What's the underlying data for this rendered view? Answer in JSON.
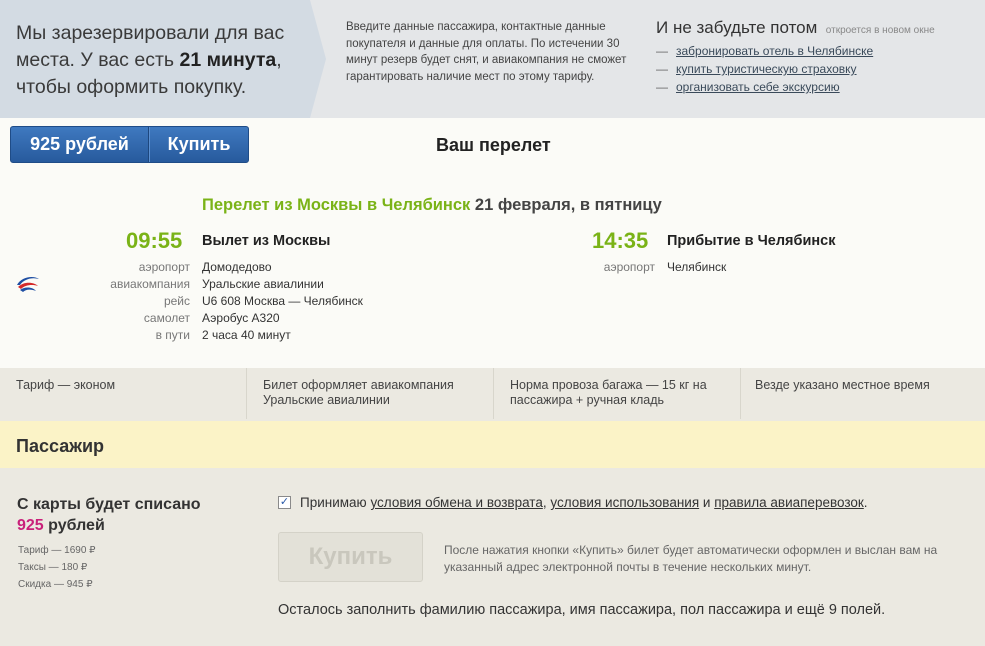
{
  "banner": {
    "line1": "Мы зарезервировали для вас",
    "line2_prefix": "места. У вас есть",
    "timer": "21 минута",
    "line2_suffix": ",",
    "line3": "чтобы оформить покупку.",
    "instructions": "Введите данные пассажира, контактные данные покупателя и данные для оплаты. По истечении 30 минут резерв будет снят, и авиакомпания не сможет гарантировать наличие мест по этому тарифу.",
    "remember_title": "И не забудьте потом",
    "remember_note": "откроется в новом окне",
    "remember_links": [
      "забронировать отель в Челябинске",
      "купить туристическую страховку",
      "организовать себе экскурсию"
    ],
    "dash": "—"
  },
  "flight": {
    "price_button": "925 рублей",
    "buy_button": "Купить",
    "section_title": "Ваш перелет",
    "route_green": "Перелет из Москвы в Челябинск",
    "route_date": "21 февраля, в пятницу",
    "departure": {
      "time": "09:55",
      "title": "Вылет из Москвы",
      "rows": [
        {
          "label": "аэропорт",
          "value": "Домодедово"
        },
        {
          "label": "авиакомпания",
          "value": "Уральские авиалинии"
        },
        {
          "label": "рейс",
          "value": "U6 608 Москва — Челябинск"
        },
        {
          "label": "самолет",
          "value": "Аэробус А320"
        },
        {
          "label": "в пути",
          "value": "2 часа 40 минут"
        }
      ]
    },
    "arrival": {
      "time": "14:35",
      "title": "Прибытие в Челябинск",
      "rows": [
        {
          "label": "аэропорт",
          "value": "Челябинск"
        }
      ]
    },
    "airline_logo": "ural-airlines-logo"
  },
  "facts": [
    "Тариф — эконом",
    "Билет оформляет авиакомпания Уральские авиалинии",
    "Норма провоза багажа — 15 кг на пассажира + ручная кладь",
    "Везде указано местное время"
  ],
  "passenger": {
    "title": "Пассажир"
  },
  "payment": {
    "charge_label": "С карты будет списано",
    "charge_amount": "925",
    "charge_currency": "рублей",
    "breakdown": [
      "Тариф — 1690 ₽",
      "Таксы — 180 ₽",
      "Скидка — 945 ₽"
    ],
    "accept_prefix": "Принимаю",
    "link_exchange": "условия обмена и возврата",
    "sep1": ",",
    "link_terms": "условия использования",
    "and": "и",
    "link_rules": "правила авиаперевозок",
    "end": ".",
    "checkbox_checked": true,
    "buy_button": "Купить",
    "buy_note": "После нажатия кнопки «Купить» билет будет автоматически оформлен и выслан вам на указанный адрес электронной почты в течение нескольких минут.",
    "remaining": "Осталось заполнить фамилию пассажира, имя пассажира, пол пассажира и ещё 9 полей."
  },
  "colors": {
    "accent_green": "#7ab317",
    "button_blue": "#275a9d",
    "price_pink": "#c9207a",
    "passenger_bg": "#fbf3c7"
  }
}
